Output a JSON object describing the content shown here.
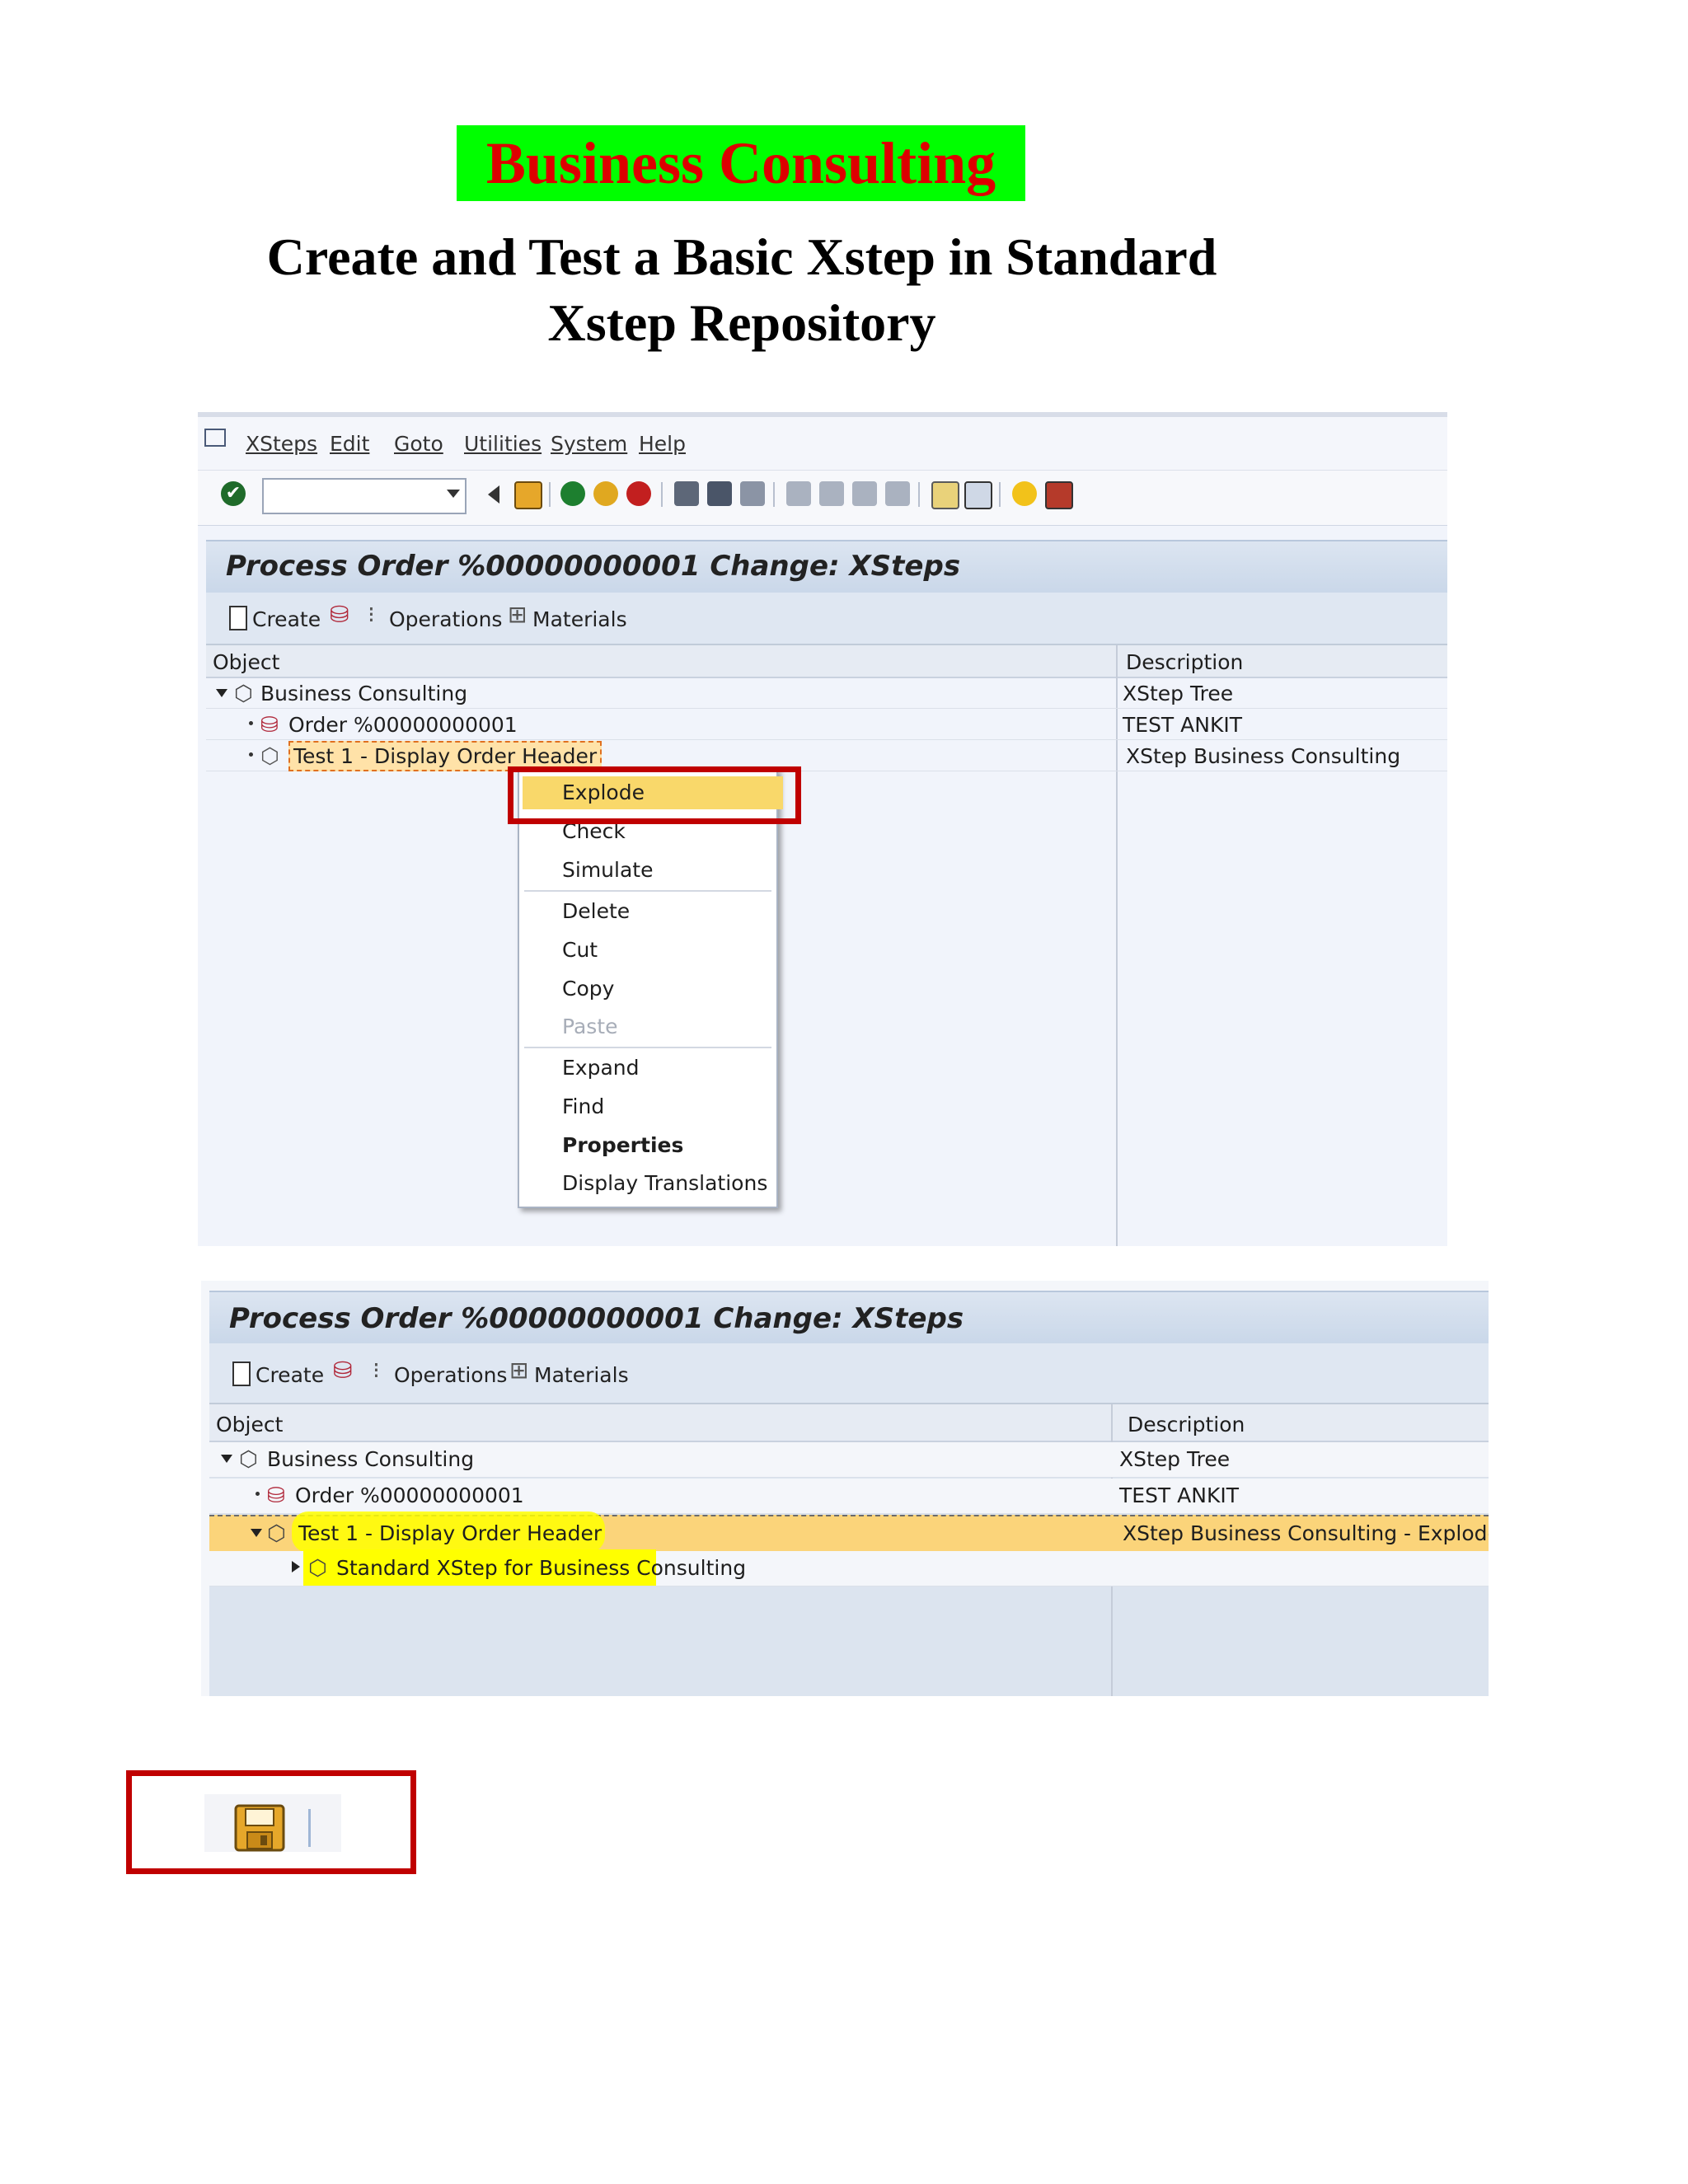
{
  "document": {
    "title": "Business Consulting",
    "subtitle_line1": "Create and Test a Basic Xstep in Standard",
    "subtitle_line2": "Xstep Repository"
  },
  "screen1": {
    "menu": [
      "XSteps",
      "Edit",
      "Goto",
      "Utilities",
      "System",
      "Help"
    ],
    "window_title": "Process Order %00000000001 Change: XSteps",
    "toolbar": {
      "create": "Create",
      "operations": "Operations",
      "materials": "Materials"
    },
    "columns": {
      "object": "Object",
      "description": "Description"
    },
    "rows": [
      {
        "label": "Business Consulting",
        "description": "XStep Tree"
      },
      {
        "label": "Order %00000000001",
        "description": "TEST ANKIT"
      },
      {
        "label": "Test 1 - Display Order Header",
        "description": "XStep Business Consulting"
      }
    ],
    "context_menu": {
      "items": [
        "Explode",
        "Check",
        "Simulate",
        "Delete",
        "Cut",
        "Copy",
        "Paste",
        "Expand",
        "Find",
        "Properties",
        "Display Translations"
      ],
      "highlighted": "Explode",
      "disabled": "Paste",
      "bold": "Properties"
    }
  },
  "screen2": {
    "window_title": "Process Order %00000000001 Change: XSteps",
    "toolbar": {
      "create": "Create",
      "operations": "Operations",
      "materials": "Materials"
    },
    "columns": {
      "object": "Object",
      "description": "Description"
    },
    "rows": [
      {
        "label": "Business Consulting",
        "description": "XStep Tree"
      },
      {
        "label": "Order %00000000001",
        "description": "TEST ANKIT"
      },
      {
        "label": "Test 1 - Display Order Header",
        "description": "XStep Business Consulting - Exploded"
      },
      {
        "label": "Standard XStep for Business Consulting",
        "description": ""
      }
    ]
  },
  "icons": {
    "menu_icon": "exit-menu-icon",
    "save_icon": "floppy-save-icon",
    "highlight_color": "#ffd24d",
    "marker_color": "#ffff00",
    "callout_color": "#c00000"
  }
}
